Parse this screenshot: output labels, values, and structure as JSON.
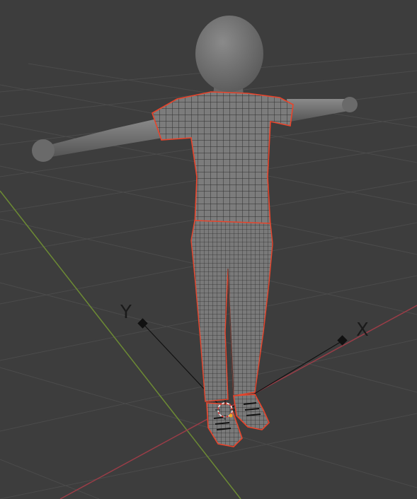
{
  "viewport": {
    "background": "#3d3d3d",
    "grid_color": "#4a4a4a",
    "x_axis_color": "#9a3d47",
    "y_axis_color": "#6c8a34",
    "selection_outline_color": "#e8442b",
    "mesh_color": "#7a7a7a",
    "wire_color": "#2b2b2b"
  },
  "gizmo": {
    "x_label": "X",
    "y_label": "Y"
  },
  "objects": [
    {
      "name": "body-mannequin",
      "selected": false
    },
    {
      "name": "outfit-mesh",
      "selected": true
    },
    {
      "name": "shoes-mesh",
      "selected": true
    }
  ],
  "icons": [
    "3d-cursor-icon"
  ]
}
